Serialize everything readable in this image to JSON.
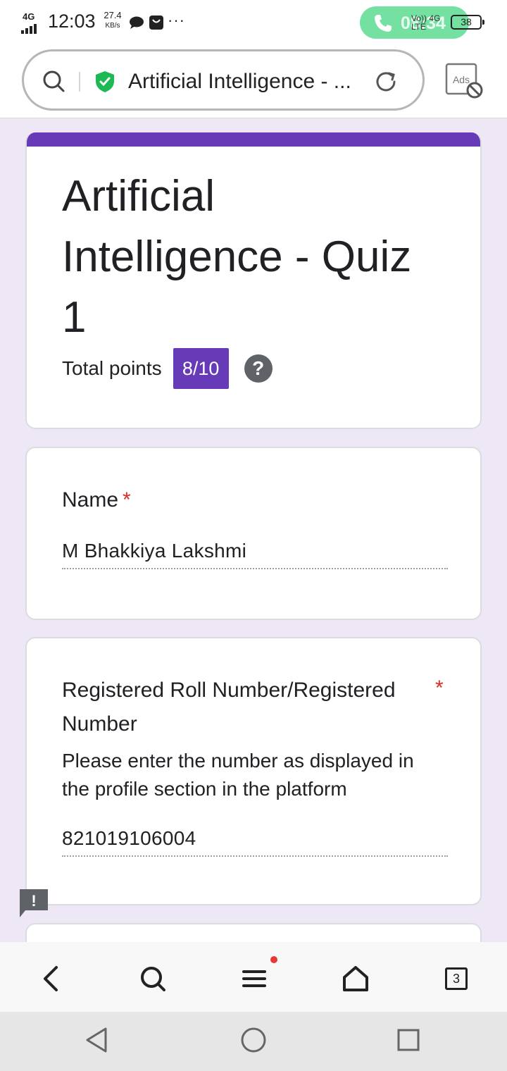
{
  "status_bar": {
    "network_label": "4G",
    "time": "12:03",
    "speed_value": "27.4",
    "speed_unit": "KB/s",
    "more": "···",
    "call_duration": "08:34",
    "lte_label_top": "Vo)) 4G",
    "lte_label_bottom": "LTE",
    "battery": "38"
  },
  "browser": {
    "url_text": "Artificial Intelligence - ...",
    "ads_label": "Ads"
  },
  "form": {
    "title": "Artificial Intelligence - Quiz 1",
    "total_points_label": "Total points",
    "score": "8/10",
    "help_symbol": "?",
    "accent_color": "#673ab7",
    "questions": [
      {
        "title": "Name",
        "required_mark": "*",
        "answer": "M Bhakkiya Lakshmi"
      },
      {
        "title": "Registered Roll Number/Registered Number",
        "required_mark": "*",
        "description": "Please enter the number as displayed in the profile section in the platform",
        "answer": "821019106004"
      }
    ]
  },
  "feedback_symbol": "!",
  "toolbar": {
    "tabs_count": "3",
    "icons": [
      "back-icon",
      "search-icon",
      "menu-icon",
      "home-icon",
      "tabs-icon"
    ]
  },
  "navbar": {
    "icons": [
      "nav-back-icon",
      "nav-home-icon",
      "nav-recent-icon"
    ]
  }
}
